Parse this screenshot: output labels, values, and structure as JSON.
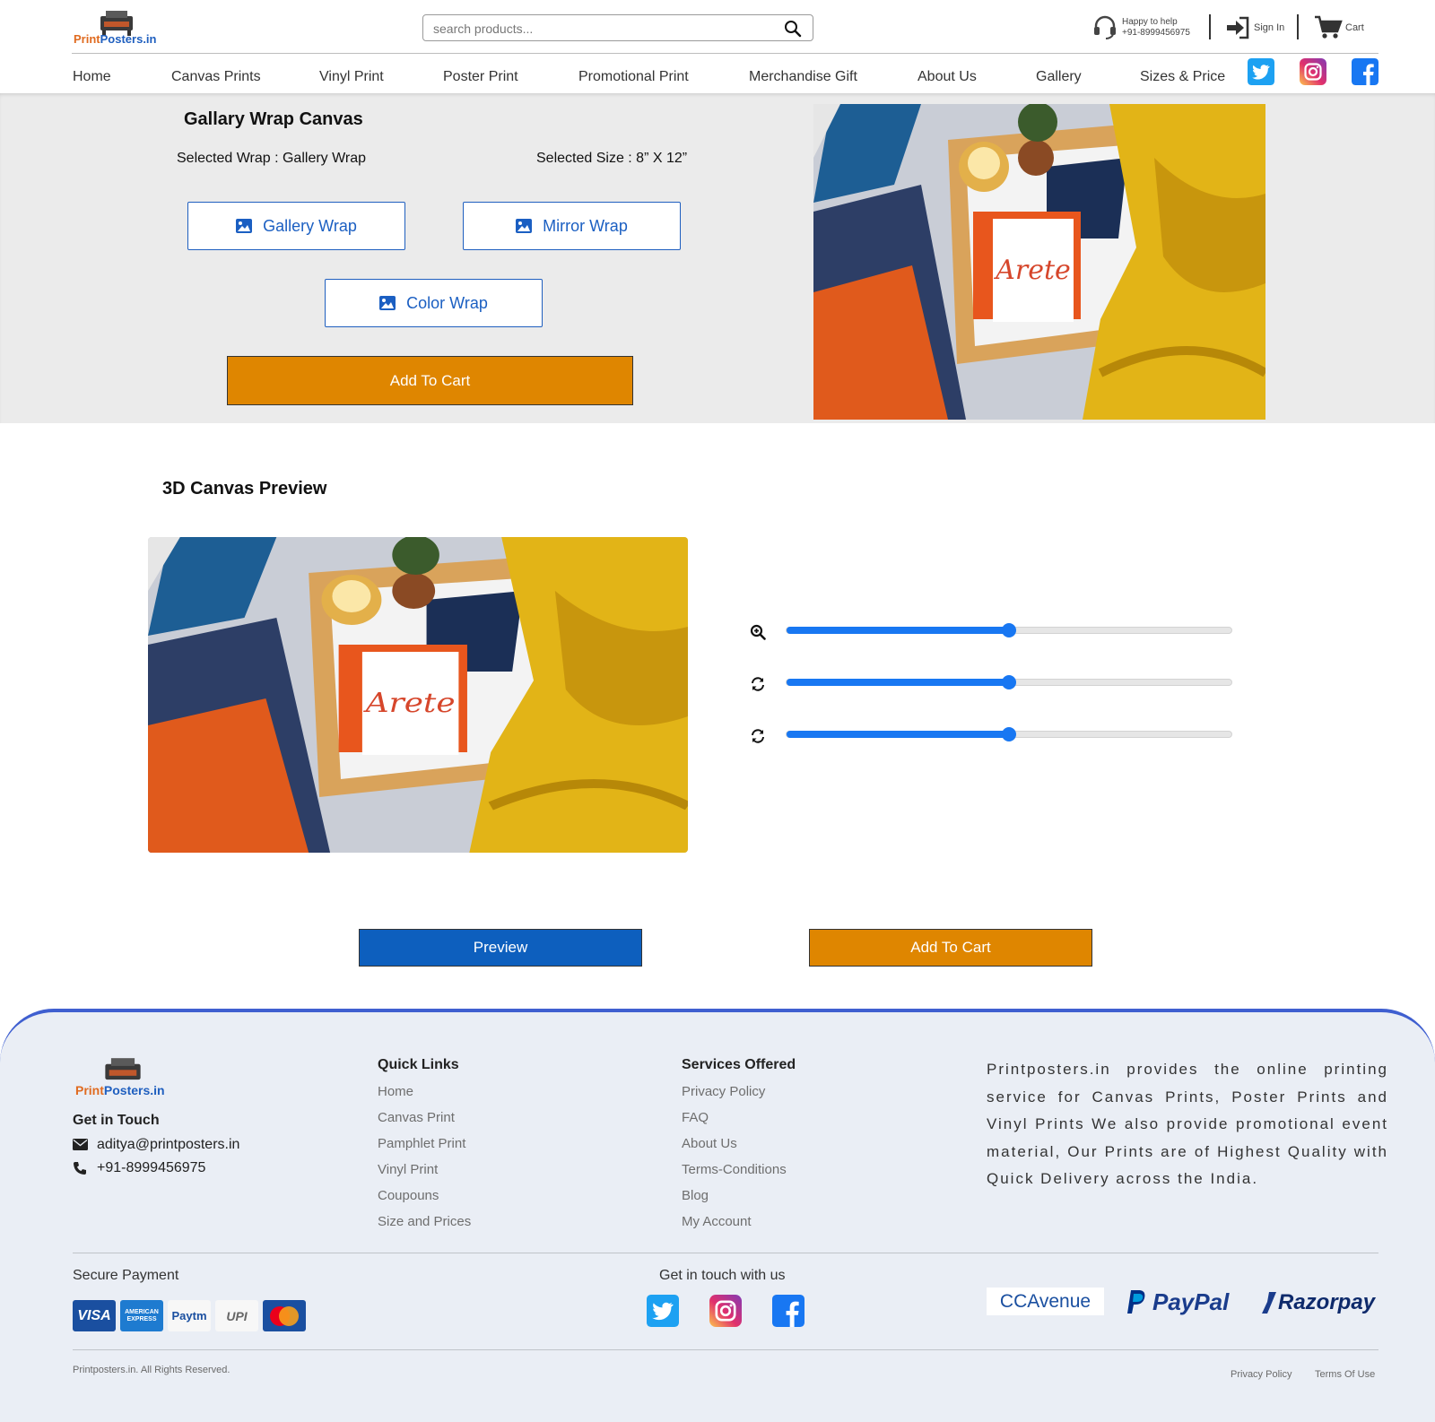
{
  "brand": {
    "name_part1": "Print",
    "name_part2": "Posters.in"
  },
  "header": {
    "search_placeholder": "search products...",
    "help_label": "Happy to help",
    "help_phone": "+91-8999456975",
    "signin_label": "Sign In",
    "cart_label": "Cart"
  },
  "nav": {
    "items": [
      "Home",
      "Canvas Prints",
      "Vinyl Print",
      "Poster Print",
      "Promotional Print",
      "Merchandise Gift",
      "About Us",
      "Gallery",
      "Sizes & Price"
    ],
    "social": [
      "twitter-icon",
      "instagram-icon",
      "facebook-icon"
    ]
  },
  "product": {
    "title": "Gallary Wrap Canvas",
    "selected_wrap": "Selected Wrap : Gallery Wrap",
    "selected_size": "Selected Size : 8” X 12”",
    "wrap_options": [
      "Gallery Wrap",
      "Mirror Wrap",
      "Color Wrap"
    ],
    "add_to_cart": "Add To Cart",
    "image_text": "Arete"
  },
  "preview": {
    "title": "3D Canvas Preview",
    "image_text": "Arete",
    "sliders": [
      {
        "name": "zoom",
        "icon": "zoom-in-icon",
        "value": 0.5
      },
      {
        "name": "rotate-x",
        "icon": "refresh-icon",
        "value": 0.5
      },
      {
        "name": "rotate-y",
        "icon": "refresh-icon",
        "value": 0.5
      }
    ],
    "preview_button": "Preview",
    "add_to_cart": "Add To Cart"
  },
  "colors": {
    "accent_blue": "#1b5fc2",
    "orange": "#df8600",
    "slider_blue": "#1877f2",
    "footer_bg": "#eaeef5",
    "footer_border": "#3f5fd0"
  },
  "footer": {
    "get_in_touch": "Get in Touch",
    "email": "aditya@printposters.in",
    "phone": "+91-8999456975",
    "quick_links_title": "Quick Links",
    "quick_links": [
      "Home",
      "Canvas Print",
      "Pamphlet Print",
      "Vinyl Print",
      "Coupouns",
      "Size and Prices"
    ],
    "services_title": "Services Offered",
    "services": [
      "Privacy Policy",
      "FAQ",
      "About Us",
      "Terms-Conditions",
      "Blog",
      "My Account"
    ],
    "description": "Printposters.in provides the online printing service for Canvas Prints, Poster Prints and Vinyl Prints We also provide promotional event material, Our Prints are of Highest Quality with Quick Delivery across the India.",
    "secure_payment": "Secure Payment",
    "payment_methods": [
      "VISA",
      "AMERICAN EXPRESS",
      "Paytm",
      "UPI",
      "mastercard"
    ],
    "get_in_touch_with_us": "Get in touch with us",
    "gateways": [
      "CCAvenue",
      "PayPal",
      "Razorpay"
    ],
    "copyright": "Printposters.in. All Rights Reserved.",
    "bottom_links": [
      "Privacy Policy",
      "Terms Of Use"
    ]
  }
}
